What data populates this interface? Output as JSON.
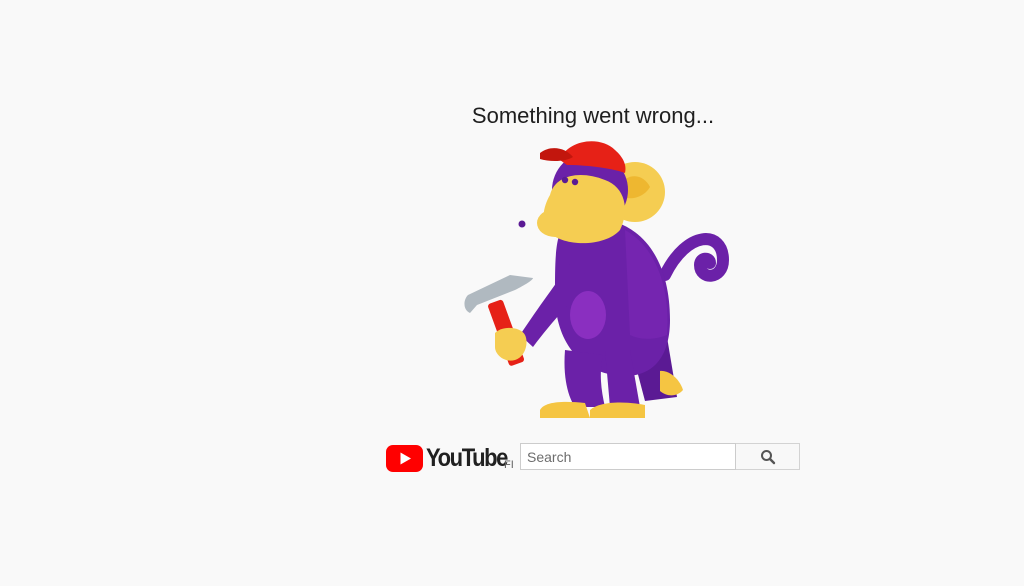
{
  "error": {
    "message": "Something went wrong..."
  },
  "illustration": {
    "name": "monkey-with-hammer",
    "colors": {
      "body": "#6b21a8",
      "face": "#f5cd52",
      "cap": "#e62117",
      "hammer_handle": "#e62117",
      "hammer_head": "#b0b9c0"
    }
  },
  "footer": {
    "logo_text": "YouTube",
    "country_code": "FI",
    "search": {
      "placeholder": "Search",
      "value": ""
    },
    "search_button_icon": "search-icon"
  },
  "colors": {
    "background": "#f9f9f9",
    "brand_red": "#ff0000",
    "text": "#1f1f1f"
  }
}
